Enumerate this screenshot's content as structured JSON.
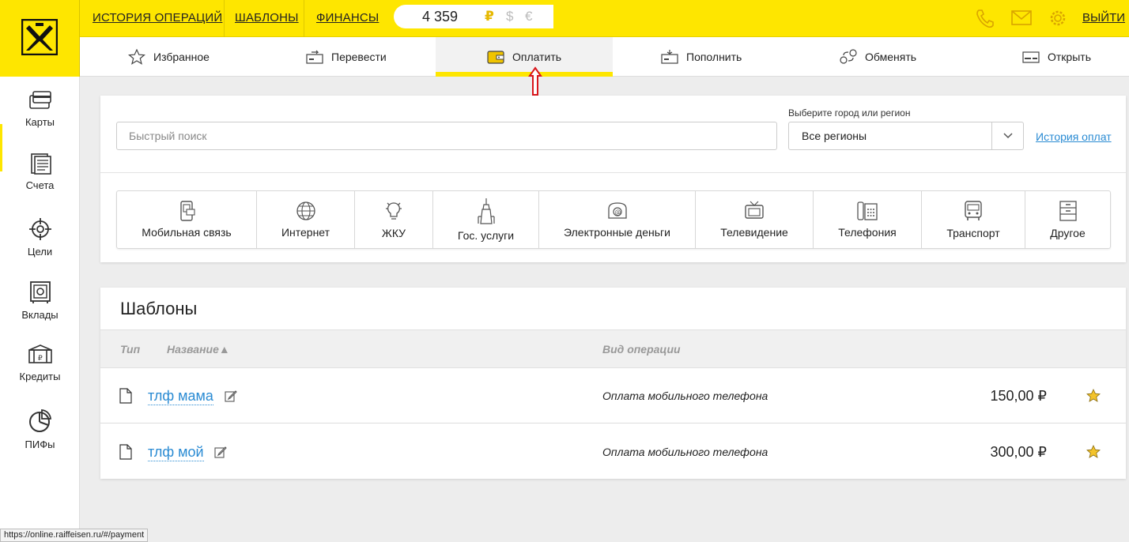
{
  "header": {
    "links": [
      "ИСТОРИЯ ОПЕРАЦИЙ",
      "ШАБЛОНЫ",
      "ФИНАНСЫ"
    ],
    "balance": "4 359",
    "currencies": [
      "₽",
      "$",
      "€"
    ],
    "logout": "ВЫЙТИ",
    "accent_color": "#fee600"
  },
  "nav": {
    "items": [
      "Избранное",
      "Перевести",
      "Оплатить",
      "Пополнить",
      "Обменять",
      "Открыть"
    ],
    "active": "Оплатить"
  },
  "sidebar": {
    "items": [
      "Карты",
      "Счета",
      "Цели",
      "Вклады",
      "Кредиты",
      "ПИФы"
    ]
  },
  "search": {
    "placeholder": "Быстрый поиск",
    "region_label": "Выберите город или регион",
    "region_value": "Все регионы",
    "history_link": "История оплат"
  },
  "categories": [
    "Мобильная связь",
    "Интернет",
    "ЖКУ",
    "Гос. услуги",
    "Электронные деньги",
    "Телевидение",
    "Телефония",
    "Транспорт",
    "Другое"
  ],
  "templates": {
    "title": "Шаблоны",
    "columns": {
      "type": "Тип",
      "name": "Название▲",
      "operation": "Вид операции"
    },
    "rows": [
      {
        "name": "тлф мама",
        "operation": "Оплата мобильного телефона",
        "amount": "150,00 ₽"
      },
      {
        "name": "тлф мой",
        "operation": "Оплата мобильного телефона",
        "amount": "300,00 ₽"
      }
    ]
  },
  "status_url": "https://online.raiffeisen.ru/#/payment"
}
